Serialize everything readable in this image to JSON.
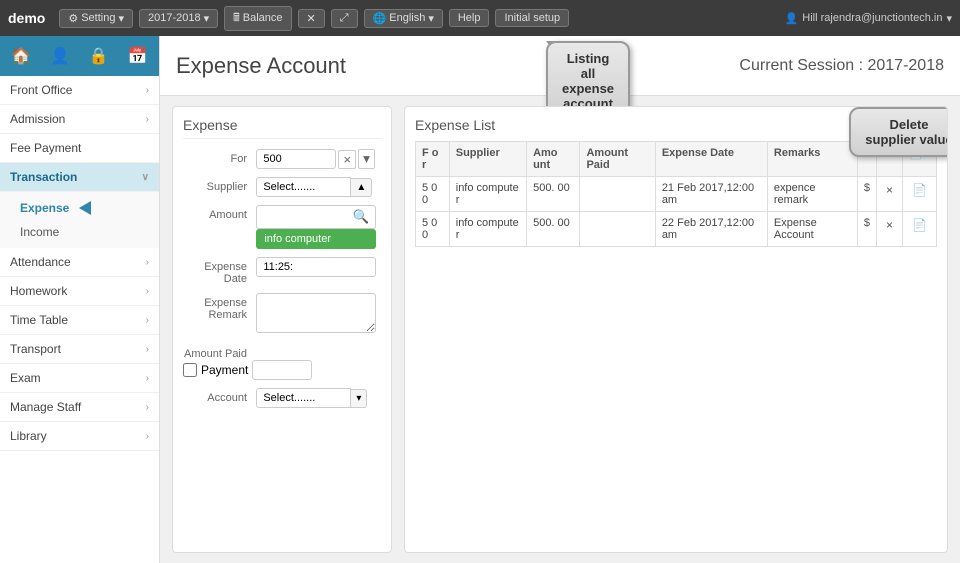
{
  "app": {
    "brand": "demo",
    "topbar": {
      "setting": "Setting",
      "year": "2017-2018",
      "balance": "Balance",
      "close_icon": "✕",
      "expand_icon": "⤢",
      "english": "English",
      "help": "Help",
      "initial_setup": "Initial setup",
      "user": "Hill rajendra@junctiontech.in"
    }
  },
  "sidebar": {
    "icons": [
      "🏠",
      "👤",
      "🔒",
      "📅"
    ],
    "items": [
      {
        "label": "Front Office",
        "has_arrow": true
      },
      {
        "label": "Admission",
        "has_arrow": true
      },
      {
        "label": "Fee Payment",
        "has_arrow": false
      },
      {
        "label": "Transaction",
        "active": true,
        "has_arrow": true
      },
      {
        "label": "Attendance",
        "has_arrow": true
      },
      {
        "label": "Homework",
        "has_arrow": true
      },
      {
        "label": "Time Table",
        "has_arrow": true
      },
      {
        "label": "Transport",
        "has_arrow": true
      },
      {
        "label": "Exam",
        "has_arrow": true
      },
      {
        "label": "Manage Staff",
        "has_arrow": true
      },
      {
        "label": "Library",
        "has_arrow": true
      }
    ],
    "sub_items": [
      {
        "label": "Expense",
        "active": true
      },
      {
        "label": "Income"
      }
    ]
  },
  "page": {
    "title": "Expense Account",
    "session": "Current Session : 2017-2018"
  },
  "annotations": {
    "listing": "Listing all expense account",
    "delete": "Delete supplier value"
  },
  "expense_form": {
    "title": "Expense",
    "for_label": "For",
    "for_value": "500",
    "supplier_label": "Supplier",
    "supplier_placeholder": "Select.......",
    "amount_label": "Amount",
    "search_icon": "🔍",
    "autocomplete": "info computer",
    "expense_date_label": "Expense Date",
    "expense_date_value": "11:25:",
    "expense_remark_label": "Expense Remark",
    "amount_paid_label": "Amount Paid",
    "payment_label": "Payment",
    "account_label": "Account",
    "account_placeholder": "Select.......",
    "select_label": "Select"
  },
  "expense_list": {
    "title": "Expense List",
    "columns": [
      "For",
      "Supplier",
      "Amount",
      "Amount Paid",
      "Expense Date",
      "Remarks",
      "$",
      "×",
      "📄"
    ],
    "rows": [
      {
        "for": "500",
        "supplier": "info computer",
        "amount": "500.00",
        "amount_paid": "",
        "expense_date": "21 Feb 2017,12:00 am",
        "remarks": "expence remark",
        "dollar": "$",
        "delete": "×",
        "doc": "📄"
      },
      {
        "for": "500",
        "supplier": "info computer",
        "amount": "500.00",
        "amount_paid": "",
        "expense_date": "22 Feb 2017,12:00 am",
        "remarks": "Expense Account",
        "dollar": "$",
        "delete": "×",
        "doc": "📄"
      }
    ]
  }
}
